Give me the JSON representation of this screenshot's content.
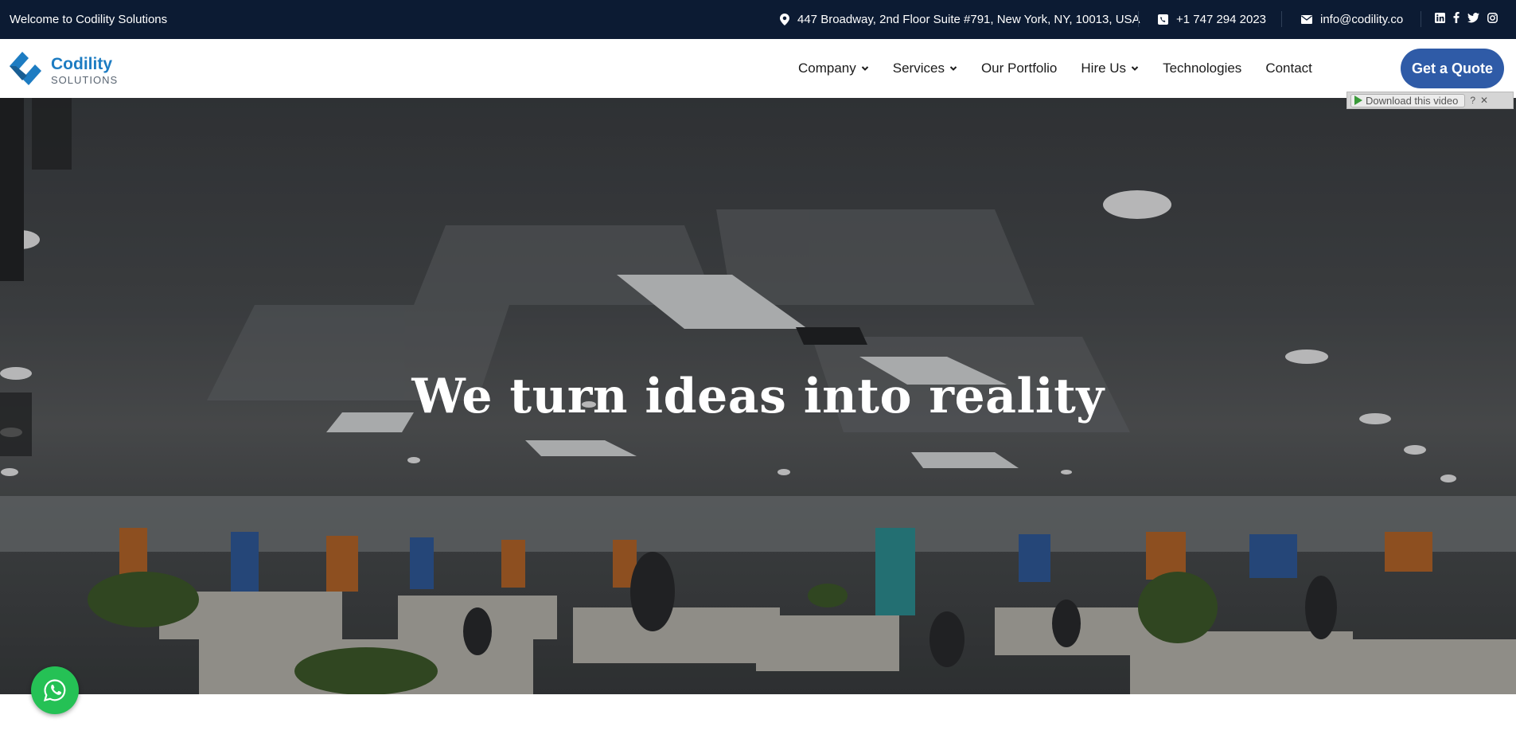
{
  "topbar": {
    "welcome": "Welcome to Codility Solutions",
    "address": "447 Broadway, 2nd Floor Suite #791, New York, NY, 10013, USA",
    "phone": "+1 747 294 2023",
    "email": "info@codility.co",
    "social": [
      "linkedin-icon",
      "facebook-icon",
      "twitter-icon",
      "instagram-icon"
    ]
  },
  "logo": {
    "brand": "Codility",
    "sub": "SOLUTIONS"
  },
  "nav": {
    "items": [
      {
        "label": "Company",
        "dropdown": true
      },
      {
        "label": "Services",
        "dropdown": true
      },
      {
        "label": "Our Portfolio",
        "dropdown": false
      },
      {
        "label": "Hire Us",
        "dropdown": true
      },
      {
        "label": "Technologies",
        "dropdown": false
      },
      {
        "label": "Contact",
        "dropdown": false
      }
    ],
    "cta": "Get a Quote"
  },
  "hero": {
    "title": "We turn ideas into reality"
  },
  "video_bar": {
    "download_label": "Download this video",
    "help": "?",
    "close": "✕"
  },
  "colors": {
    "topbar_bg": "#0c1b33",
    "brand": "#1d7cc2",
    "cta_bg": "#2f5ba7",
    "whatsapp": "#25c155"
  }
}
